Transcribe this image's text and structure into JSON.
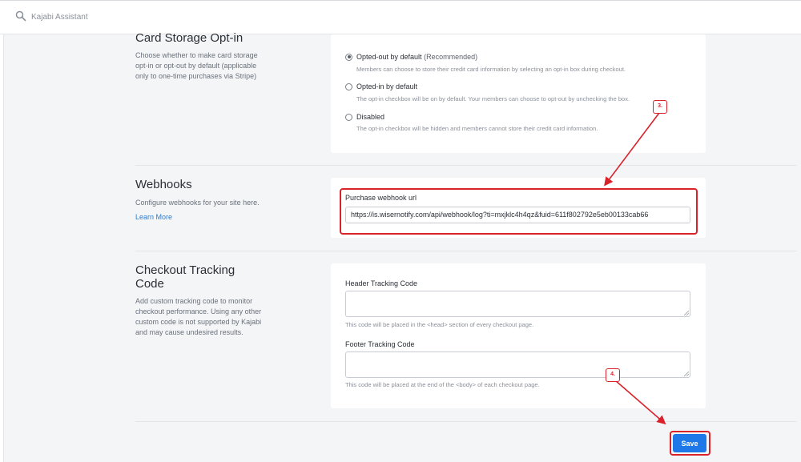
{
  "topbar": {
    "assistant_label": "Kajabi Assistant"
  },
  "card_storage": {
    "title": "Card Storage Opt-in",
    "description": "Choose whether to make card storage opt-in or opt-out by default (applicable only to one-time purchases via Stripe)",
    "options": [
      {
        "label": "Opted-out by default",
        "suffix": "(Recommended)",
        "help": "Members can choose to store their credit card information by selecting an opt-in box during checkout.",
        "checked": true
      },
      {
        "label": "Opted-in by default",
        "suffix": "",
        "help": "The opt-in checkbox will be on by default. Your members can choose to opt-out by unchecking the box.",
        "checked": false
      },
      {
        "label": "Disabled",
        "suffix": "",
        "help": "The opt-in checkbox will be hidden and members cannot store their credit card information.",
        "checked": false
      }
    ]
  },
  "webhooks": {
    "title": "Webhooks",
    "description": "Configure webhooks for your site here.",
    "learn_more": "Learn More",
    "purchase_label": "Purchase webhook url",
    "purchase_value": "https://is.wisernotify.com/api/webhook/log?ti=mxjklc4h4qz&fuid=611f802792e5eb00133cab66"
  },
  "checkout_tracking": {
    "title_line1": "Checkout Tracking",
    "title_line2": "Code",
    "description": "Add custom tracking code to monitor checkout performance. Using any other custom code is not supported by Kajabi and may cause undesired results.",
    "header_label": "Header Tracking Code",
    "header_help": "This code will be placed in the <head> section of every checkout page.",
    "footer_label": "Footer Tracking Code",
    "footer_help": "This code will be placed at the end of the <body> of each checkout page."
  },
  "annotations": {
    "step3": "3.",
    "step4": "4."
  },
  "save_label": "Save",
  "colors": {
    "accent": "#1f78e8",
    "annotation": "#d9222a",
    "link": "#2d7dd2"
  }
}
